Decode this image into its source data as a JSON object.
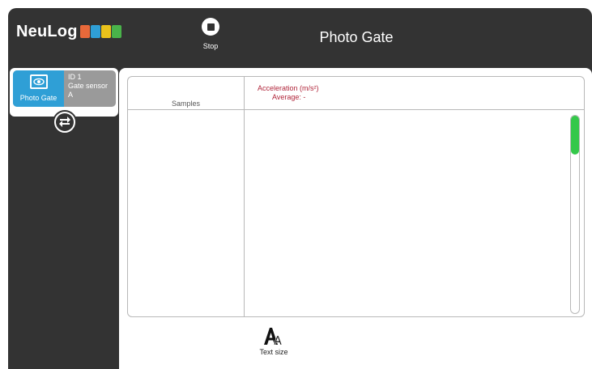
{
  "header": {
    "logo_text": "NeuLog",
    "logo_colors": [
      "#e8693a",
      "#2f9fd6",
      "#e9c21b",
      "#49b34a"
    ],
    "stop_label": "Stop",
    "title": "Photo Gate"
  },
  "sidebar": {
    "sensor": {
      "name": "Photo Gate",
      "id_line": "ID 1",
      "type_line": "Gate sensor",
      "mode_line": "A",
      "icon": "eye-icon"
    },
    "swap_icon": "swap-arrows-icon"
  },
  "table": {
    "columns": [
      {
        "label": "Samples"
      },
      {
        "label": "Acceleration (m/s²)",
        "sub": "Average: -"
      }
    ],
    "rows": []
  },
  "toolbar": {
    "text_size_label": "Text size"
  },
  "colors": {
    "background": "#333333",
    "accent_blue": "#2f9fd6",
    "column_header_red": "#b0253a",
    "scroll_green": "#34c84a"
  }
}
